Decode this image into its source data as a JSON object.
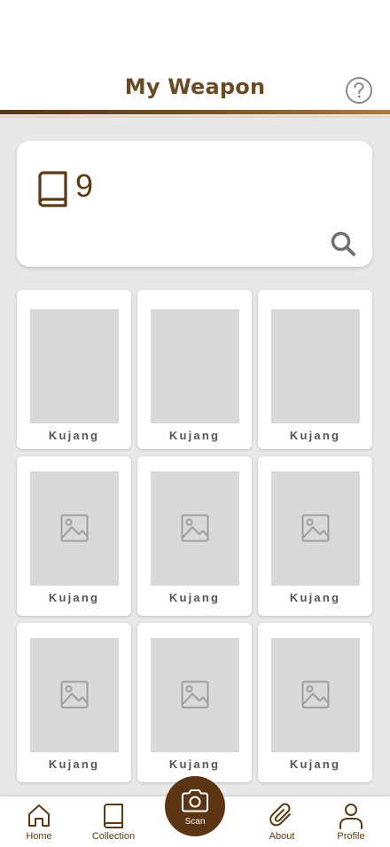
{
  "header": {
    "title": "My Weapon",
    "help_icon": "question-circle-icon"
  },
  "summary": {
    "icon": "book-icon",
    "count": "9",
    "search_icon": "search-icon"
  },
  "grid": {
    "items": [
      {
        "label": "Kujang",
        "image": "blank"
      },
      {
        "label": "Kujang",
        "image": "blank"
      },
      {
        "label": "Kujang",
        "image": "blank"
      },
      {
        "label": "Kujang",
        "image": "image-placeholder-icon"
      },
      {
        "label": "Kujang",
        "image": "image-placeholder-icon"
      },
      {
        "label": "Kujang",
        "image": "image-placeholder-icon"
      },
      {
        "label": "Kujang",
        "image": "image-placeholder-icon"
      },
      {
        "label": "Kujang",
        "image": "image-placeholder-icon"
      },
      {
        "label": "Kujang",
        "image": "image-placeholder-icon"
      }
    ]
  },
  "nav": {
    "home": "Home",
    "collection": "Collection",
    "scan": "Scan",
    "about": "About",
    "profile": "Profile"
  },
  "colors": {
    "brand": "#5b3412",
    "title": "#6b4a26",
    "background": "#e8e8e8"
  }
}
